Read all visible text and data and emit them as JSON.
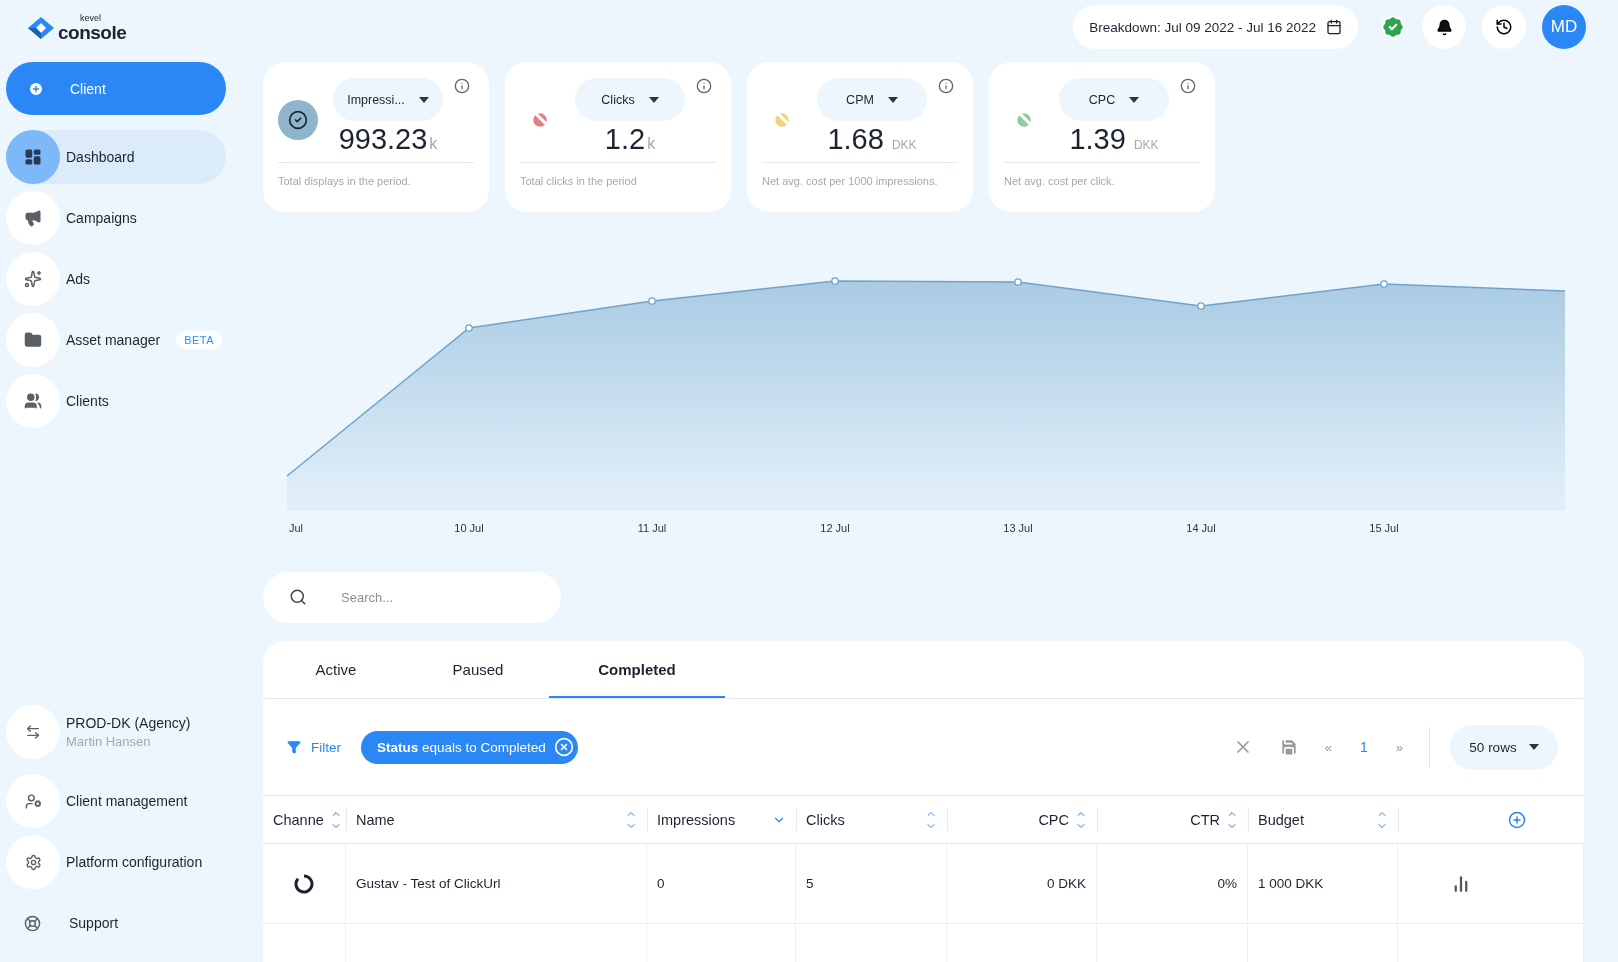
{
  "logo": {
    "small": "kevel",
    "name": "console"
  },
  "client_button": "Client",
  "nav": [
    {
      "label": "Dashboard",
      "selected": true
    },
    {
      "label": "Campaigns",
      "selected": false
    },
    {
      "label": "Ads",
      "selected": false
    },
    {
      "label": "Asset manager",
      "selected": false,
      "badge": "BETA"
    },
    {
      "label": "Clients",
      "selected": false
    }
  ],
  "account": {
    "name": "PROD-DK (Agency)",
    "user": "Martin Hansen"
  },
  "bottom_nav": [
    {
      "label": "Client management",
      "kind": "usercog"
    },
    {
      "label": "Platform configuration",
      "kind": "gear"
    },
    {
      "label": "Support",
      "kind": "lifebuoy"
    }
  ],
  "header": {
    "breakdown": "Breakdown: Jul 09 2022 - Jul 16 2022",
    "avatar": "MD"
  },
  "kpis": [
    {
      "metric": "Impressi...",
      "value": "993.23",
      "unit": "k",
      "description": "Total displays in the period.",
      "selected": true,
      "color": "#8fb5cd"
    },
    {
      "metric": "Clicks",
      "value": "1.2",
      "unit": "k",
      "description": "Total clicks in the period",
      "selected": false,
      "color": "#e57f86"
    },
    {
      "metric": "CPM",
      "value": "1.68",
      "unit": "DKK",
      "description": "Net avg. cost per 1000 impressions.",
      "selected": false,
      "color": "#f4d27a"
    },
    {
      "metric": "CPC",
      "value": "1.39",
      "unit": "DKK",
      "description": "Net avg. cost per click.",
      "selected": false,
      "color": "#8dcca4"
    }
  ],
  "chart": {
    "x_labels": [
      "Jul",
      "10 Jul",
      "11 Jul",
      "12 Jul",
      "13 Jul",
      "14 Jul",
      "15 Jul"
    ]
  },
  "search": {
    "placeholder": "Search..."
  },
  "tabs": [
    {
      "label": "Active",
      "selected": false
    },
    {
      "label": "Paused",
      "selected": false
    },
    {
      "label": "Completed",
      "selected": true
    }
  ],
  "filter": {
    "label": "Filter",
    "chip": "**Status** equals to Completed"
  },
  "pagination": {
    "prev": "«",
    "page": "1",
    "next": "»"
  },
  "rows_select": "50 rows",
  "columns": [
    {
      "label": "Channe",
      "kind": "text"
    },
    {
      "label": "Name",
      "kind": "text"
    },
    {
      "label": "Impressions",
      "kind": "sorted"
    },
    {
      "label": "Clicks",
      "kind": "text"
    },
    {
      "label": "CPC",
      "kind": "numeric"
    },
    {
      "label": "CTR",
      "kind": "numeric"
    },
    {
      "label": "Budget",
      "kind": "text"
    }
  ],
  "rows": [
    {
      "cells": [
        "Gustav - Test of ClickUrl",
        "0",
        "5",
        "0 DKK",
        "0%",
        "1 000 DKK"
      ]
    }
  ]
}
